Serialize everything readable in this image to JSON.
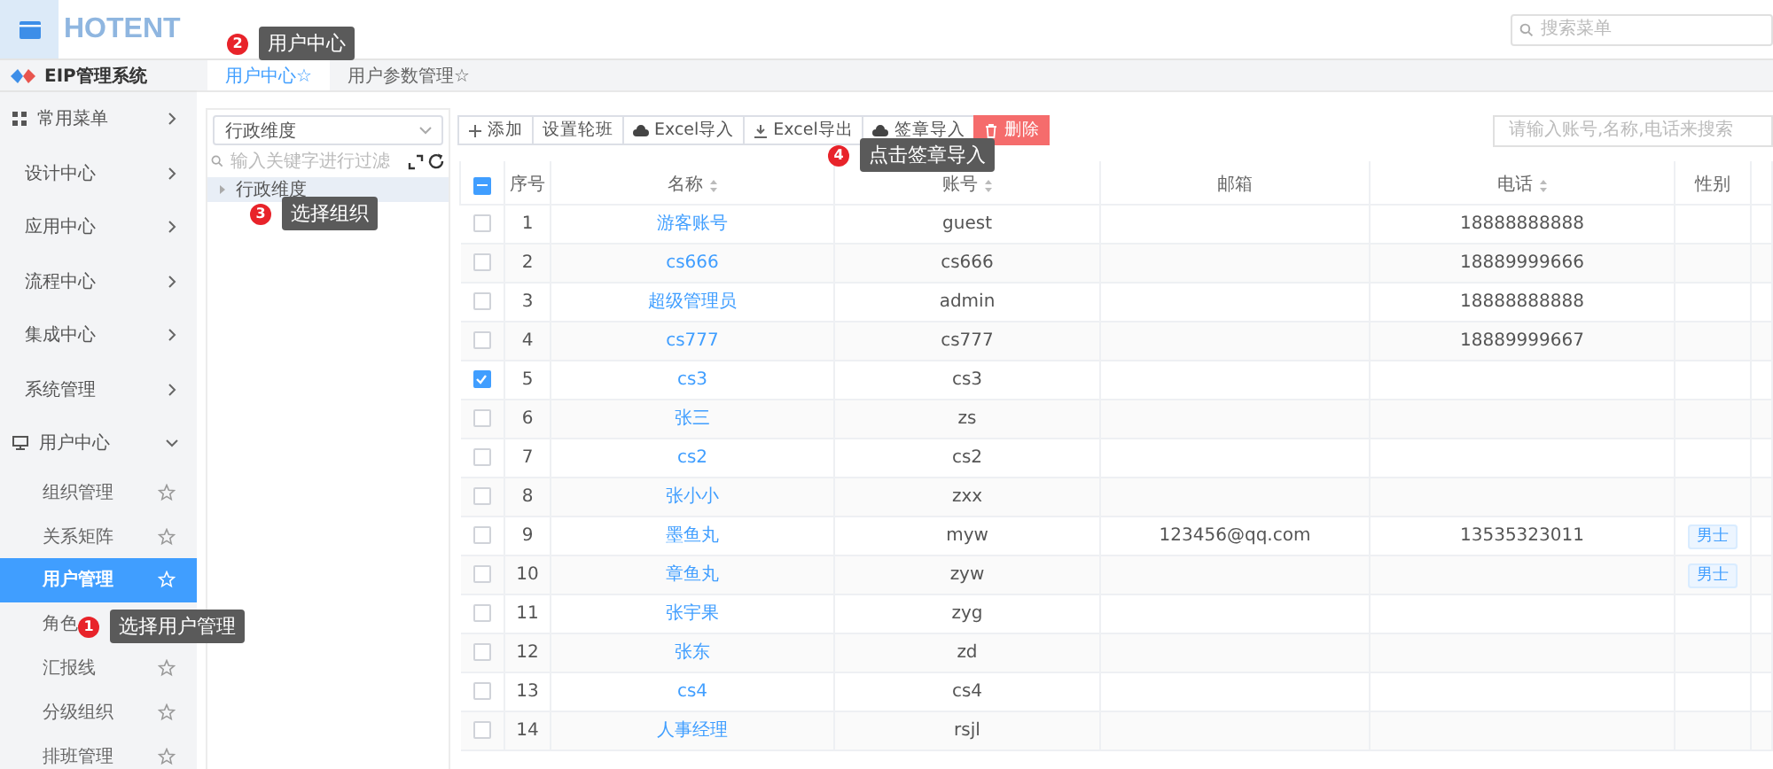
{
  "topbar": {
    "logo": "HOTENT",
    "search": {
      "placeholder": "搜索菜单"
    }
  },
  "sidebar": {
    "title": "EIP管理系统",
    "items": [
      {
        "label": "常用菜单",
        "expanded": false
      },
      {
        "label": "设计中心",
        "expanded": false
      },
      {
        "label": "应用中心",
        "expanded": false
      },
      {
        "label": "流程中心",
        "expanded": false
      },
      {
        "label": "集成中心",
        "expanded": false
      },
      {
        "label": "系统管理",
        "expanded": false
      },
      {
        "label": "用户中心",
        "expanded": true,
        "children": [
          {
            "label": "组织管理",
            "selected": false,
            "starred": true
          },
          {
            "label": "关系矩阵",
            "selected": false,
            "starred": true
          },
          {
            "label": "用户管理",
            "selected": true,
            "starred": true
          },
          {
            "label": "角色",
            "selected": false
          },
          {
            "label": "汇报线",
            "selected": false,
            "starred": true
          },
          {
            "label": "分级组织",
            "selected": false,
            "starred": true
          },
          {
            "label": "排班管理",
            "selected": false,
            "starred": true
          }
        ]
      }
    ]
  },
  "tabs": [
    {
      "label": "用户中心☆",
      "selected": true
    },
    {
      "label": "用户参数管理☆",
      "selected": false
    }
  ],
  "tree": {
    "dimension": "行政维度",
    "filter": {
      "placeholder": "输入关键字进行过滤"
    },
    "nodes": [
      {
        "label": "行政维度",
        "selected": true
      }
    ]
  },
  "toolbar": [
    {
      "label": "添加",
      "kind": "add"
    },
    {
      "label": "设置轮班",
      "kind": "plain"
    },
    {
      "label": "Excel导入",
      "kind": "upload"
    },
    {
      "label": "Excel导出",
      "kind": "download"
    },
    {
      "label": "签章导入",
      "kind": "upload"
    },
    {
      "label": "删除",
      "kind": "danger"
    }
  ],
  "search": {
    "placeholder": "请输入账号,名称,电话来搜索"
  },
  "table": {
    "header_checkbox": {
      "indeterminate": true
    },
    "columns": [
      {
        "label": "序号",
        "sortable": false
      },
      {
        "label": "名称",
        "sortable": true
      },
      {
        "label": "账号",
        "sortable": true
      },
      {
        "label": "邮箱",
        "sortable": false
      },
      {
        "label": "电话",
        "sortable": true
      },
      {
        "label": "性别",
        "sortable": false
      }
    ],
    "rows": [
      {
        "no": "1",
        "name": "游客账号",
        "account": "guest",
        "phone": "18888888888",
        "checked": false
      },
      {
        "no": "2",
        "name": "cs666",
        "account": "cs666",
        "phone": "18889999666",
        "checked": false
      },
      {
        "no": "3",
        "name": "超级管理员",
        "account": "admin",
        "phone": "18888888888",
        "checked": false
      },
      {
        "no": "4",
        "name": "cs777",
        "account": "cs777",
        "phone": "18889999667",
        "checked": false
      },
      {
        "no": "5",
        "name": "cs3",
        "account": "cs3",
        "checked": true
      },
      {
        "no": "6",
        "name": "张三",
        "account": "zs",
        "checked": false
      },
      {
        "no": "7",
        "name": "cs2",
        "account": "cs2",
        "checked": false
      },
      {
        "no": "8",
        "name": "张小小",
        "account": "zxx",
        "checked": false
      },
      {
        "no": "9",
        "name": "墨鱼丸",
        "account": "myw",
        "email": "123456@qq.com",
        "phone": "13535323011",
        "gender": "男士",
        "checked": false
      },
      {
        "no": "10",
        "name": "章鱼丸",
        "account": "zyw",
        "gender": "男士",
        "checked": false
      },
      {
        "no": "11",
        "name": "张宇果",
        "account": "zyg",
        "checked": false
      },
      {
        "no": "12",
        "name": "张东",
        "account": "zd",
        "checked": false
      },
      {
        "no": "13",
        "name": "cs4",
        "account": "cs4",
        "checked": false
      },
      {
        "no": "14",
        "name": "人事经理",
        "account": "rsjl",
        "checked": false
      }
    ]
  },
  "callouts": [
    {
      "number": "1",
      "text": "选择用户管理"
    },
    {
      "number": "2",
      "text": "用户中心"
    },
    {
      "number": "3",
      "text": "选择组织"
    },
    {
      "number": "4",
      "text": "点击签章导入"
    }
  ]
}
